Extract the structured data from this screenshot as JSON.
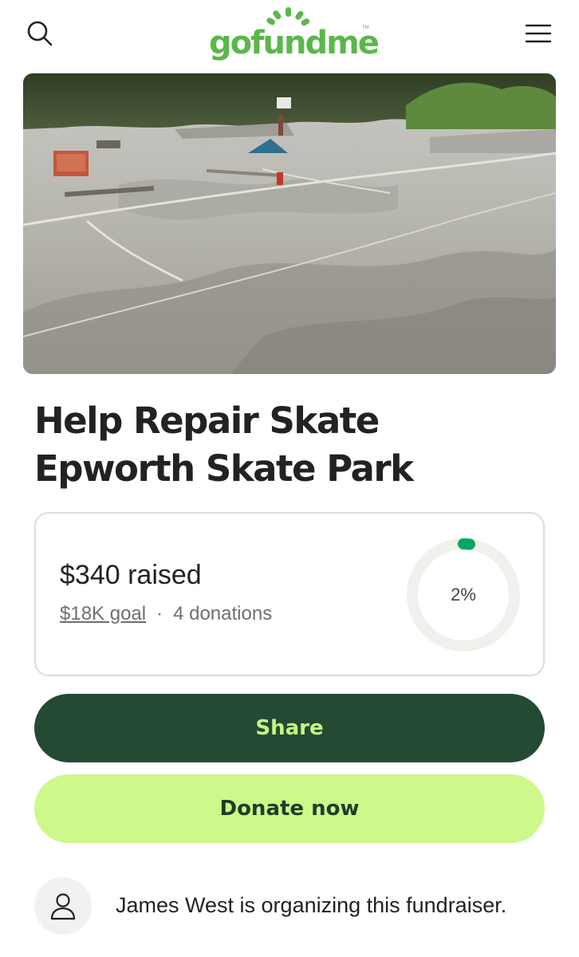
{
  "header": {
    "logo_text": "gofundme",
    "search_icon": "search-icon",
    "menu_icon": "hamburger-menu-icon"
  },
  "hero": {
    "image": "skate-park-photo"
  },
  "campaign": {
    "title": "Help Repair Skate Epworth Skate Park"
  },
  "progress": {
    "raised_text": "$340 raised",
    "goal_text": "$18K goal",
    "separator": "·",
    "donations_text": "4 donations",
    "percent_label": "2%",
    "percent_value": 0.02
  },
  "actions": {
    "share_label": "Share",
    "donate_label": "Donate now"
  },
  "organizer": {
    "text": "James West is organizing this fundraiser.",
    "avatar_icon": "user-icon"
  },
  "colors": {
    "brand_green": "#5bb74a",
    "share_bg": "#254a33",
    "share_text": "#c6f484",
    "donate_bg": "#cdf88a",
    "progress_green": "#02a95c"
  }
}
